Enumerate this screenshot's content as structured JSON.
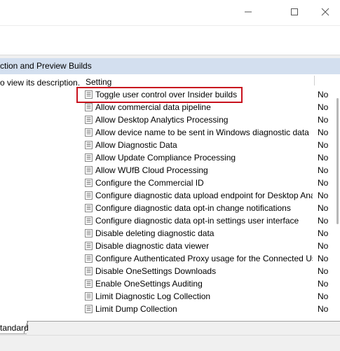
{
  "window": {
    "minimize_icon": "minimize-icon",
    "maximize_icon": "maximize-icon",
    "close_icon": "close-icon"
  },
  "section_title": "ction and Preview Builds",
  "left_description": "o view its description.",
  "columns": {
    "setting": "Setting"
  },
  "rows": [
    {
      "label": "Toggle user control over Insider builds",
      "state": "No",
      "highlighted": true
    },
    {
      "label": "Allow commercial data pipeline",
      "state": "No"
    },
    {
      "label": "Allow Desktop Analytics Processing",
      "state": "No"
    },
    {
      "label": "Allow device name to be sent in Windows diagnostic data",
      "state": "No"
    },
    {
      "label": "Allow Diagnostic Data",
      "state": "No"
    },
    {
      "label": "Allow Update Compliance Processing",
      "state": "No"
    },
    {
      "label": "Allow WUfB Cloud Processing",
      "state": "No"
    },
    {
      "label": "Configure the Commercial ID",
      "state": "No"
    },
    {
      "label": "Configure diagnostic data upload endpoint for Desktop Ana...",
      "state": "No"
    },
    {
      "label": "Configure diagnostic data opt-in change notifications",
      "state": "No"
    },
    {
      "label": "Configure diagnostic data opt-in settings user interface",
      "state": "No"
    },
    {
      "label": "Disable deleting diagnostic data",
      "state": "No"
    },
    {
      "label": "Disable diagnostic data viewer",
      "state": "No"
    },
    {
      "label": "Configure Authenticated Proxy usage for the Connected Us...",
      "state": "No"
    },
    {
      "label": "Disable OneSettings Downloads",
      "state": "No"
    },
    {
      "label": "Enable OneSettings Auditing",
      "state": "No"
    },
    {
      "label": "Limit Diagnostic Log Collection",
      "state": "No"
    },
    {
      "label": "Limit Dump Collection",
      "state": "No"
    }
  ],
  "tabs": [
    {
      "label": "tandard"
    }
  ],
  "colors": {
    "header_band": "#d3dfef",
    "highlight": "#c8121e"
  }
}
